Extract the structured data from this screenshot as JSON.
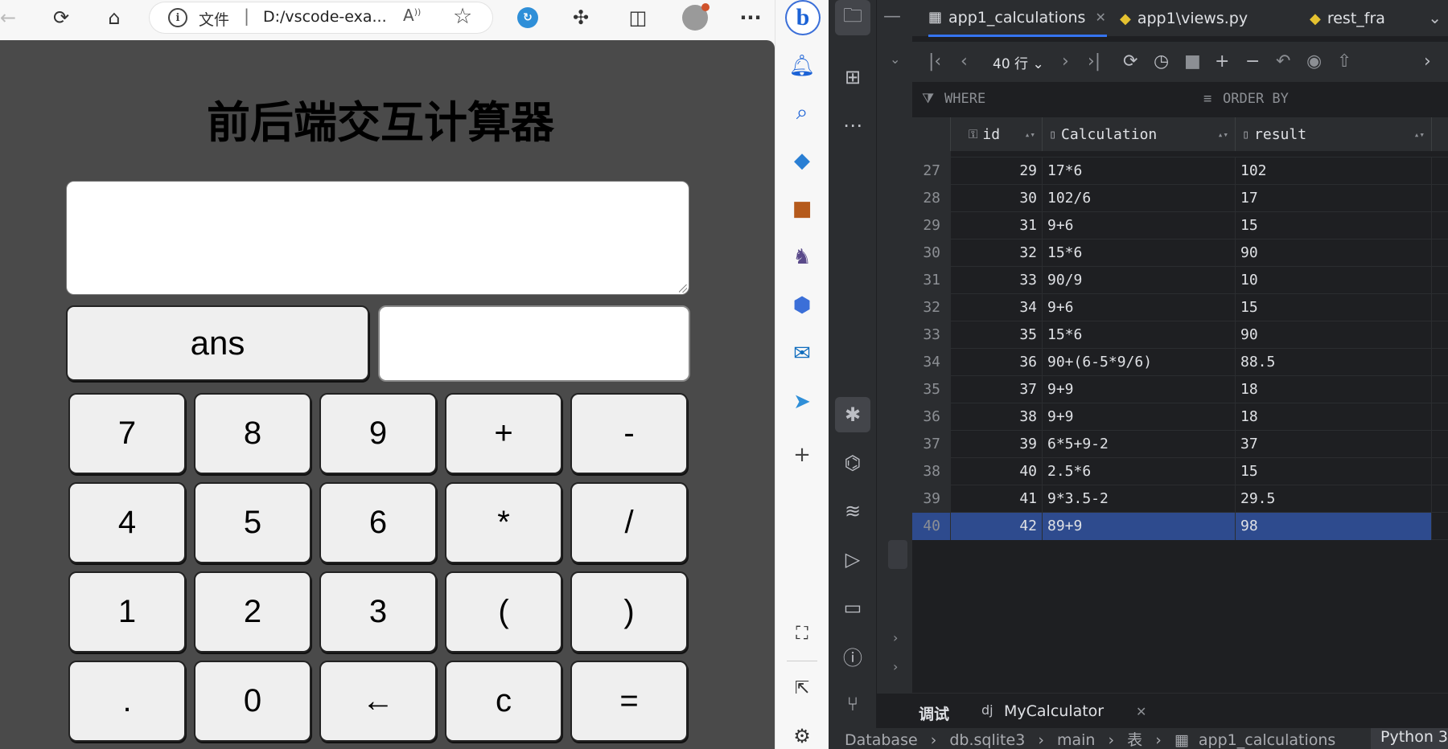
{
  "browser": {
    "address": {
      "scheme": "文件",
      "separator": "|",
      "url": "D:/vscode-exa..."
    },
    "bing_label": "b"
  },
  "calculator": {
    "title": "前后端交互计算器",
    "display_value": "",
    "ans_label": "ans",
    "ans_value": "",
    "keys": [
      [
        "7",
        "8",
        "9",
        "+",
        "-"
      ],
      [
        "4",
        "5",
        "6",
        "*",
        "/"
      ],
      [
        "1",
        "2",
        "3",
        "(",
        ")"
      ],
      [
        ".",
        "0",
        "←",
        "c",
        "="
      ]
    ]
  },
  "ide": {
    "tabs": [
      {
        "label": "app1_calculations",
        "icon": "table-icon"
      },
      {
        "label": "app1\\views.py",
        "icon": "python-icon"
      },
      {
        "label": "rest_fra",
        "icon": "python-icon"
      }
    ],
    "page_size": "40 行",
    "where_label": "WHERE",
    "order_label": "ORDER BY",
    "columns": [
      "id",
      "Calculation",
      "result"
    ],
    "rows": [
      {
        "rn": "27",
        "id": "29",
        "calc": "17*6",
        "result": "102"
      },
      {
        "rn": "28",
        "id": "30",
        "calc": "102/6",
        "result": "17"
      },
      {
        "rn": "29",
        "id": "31",
        "calc": "9+6",
        "result": "15"
      },
      {
        "rn": "30",
        "id": "32",
        "calc": "15*6",
        "result": "90"
      },
      {
        "rn": "31",
        "id": "33",
        "calc": "90/9",
        "result": "10"
      },
      {
        "rn": "32",
        "id": "34",
        "calc": "9+6",
        "result": "15"
      },
      {
        "rn": "33",
        "id": "35",
        "calc": "15*6",
        "result": "90"
      },
      {
        "rn": "34",
        "id": "36",
        "calc": "90+(6-5*9/6)",
        "result": "88.5"
      },
      {
        "rn": "35",
        "id": "37",
        "calc": "9+9",
        "result": "18"
      },
      {
        "rn": "36",
        "id": "38",
        "calc": "9+9",
        "result": "18"
      },
      {
        "rn": "37",
        "id": "39",
        "calc": "6*5+9-2",
        "result": "37"
      },
      {
        "rn": "38",
        "id": "40",
        "calc": "2.5*6",
        "result": "15"
      },
      {
        "rn": "39",
        "id": "41",
        "calc": "9*3.5-2",
        "result": "29.5"
      },
      {
        "rn": "40",
        "id": "42",
        "calc": "89+9",
        "result": "98"
      }
    ],
    "bottom_tabs": {
      "debug": "调试",
      "run_config": "MyCalculator"
    },
    "breadcrumb": [
      "Database",
      "db.sqlite3",
      "main",
      "表",
      "app1_calculations"
    ],
    "status_right": "Python 3"
  }
}
